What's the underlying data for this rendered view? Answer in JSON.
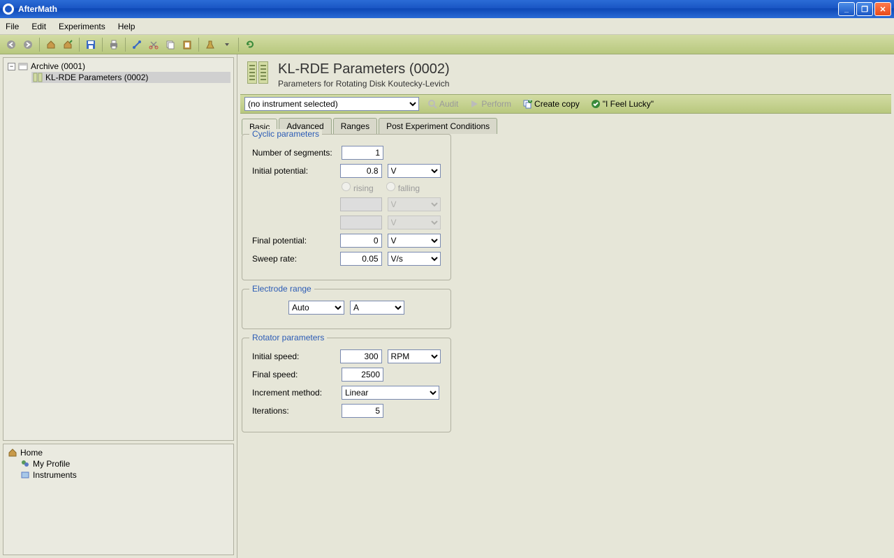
{
  "window": {
    "title": "AfterMath"
  },
  "menu": {
    "file": "File",
    "edit": "Edit",
    "experiments": "Experiments",
    "help": "Help"
  },
  "tree_top": {
    "root": "Archive (0001)",
    "child": "KL-RDE Parameters (0002)"
  },
  "tree_bottom": {
    "root": "Home",
    "profile": "My Profile",
    "instruments": "Instruments"
  },
  "header": {
    "title": "KL-RDE Parameters (0002)",
    "subtitle": "Parameters for Rotating Disk Koutecky-Levich"
  },
  "actionbar": {
    "instrument_selected": "(no instrument selected)",
    "audit": "Audit",
    "perform": "Perform",
    "create_copy": "Create copy",
    "feel_lucky": "\"I Feel Lucky\""
  },
  "tabs": {
    "basic": "Basic",
    "advanced": "Advanced",
    "ranges": "Ranges",
    "post": "Post Experiment Conditions"
  },
  "groups": {
    "cyclic": {
      "legend": "Cyclic parameters",
      "segments_label": "Number of segments:",
      "segments": "1",
      "initial_pot_label": "Initial potential:",
      "initial_pot": "0.8",
      "unit_v": "V",
      "rising": "rising",
      "falling": "falling",
      "final_pot_label": "Final potential:",
      "final_pot": "0",
      "sweep_label": "Sweep rate:",
      "sweep": "0.05",
      "unit_vs": "V/s"
    },
    "electrode": {
      "legend": "Electrode range",
      "auto": "Auto",
      "unit_a": "A"
    },
    "rotator": {
      "legend": "Rotator parameters",
      "initial_label": "Initial speed:",
      "initial": "300",
      "unit_rpm": "RPM",
      "final_label": "Final speed:",
      "final": "2500",
      "inc_label": "Increment method:",
      "inc_method": "Linear",
      "iter_label": "Iterations:",
      "iter": "5"
    }
  }
}
